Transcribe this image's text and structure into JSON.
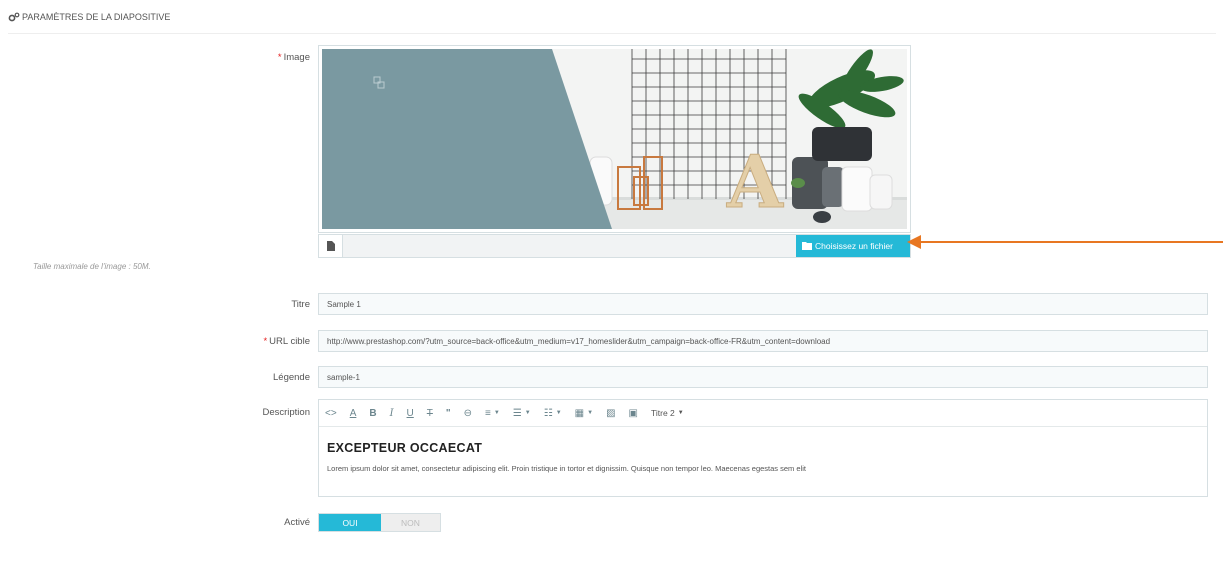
{
  "panel": {
    "heading": "PARAMÈTRES DE LA DIAPOSITIVE",
    "heading_icon": "cogs-icon"
  },
  "image_field": {
    "required_mark": "*",
    "label": "Image",
    "choose_button": "Choisissez un fichier",
    "help": "Taille maximale de l'image : 50M."
  },
  "title_field": {
    "label": "Titre",
    "value": "Sample 1"
  },
  "url_field": {
    "required_mark": "*",
    "label": "URL cible",
    "value": "http://www.prestashop.com/?utm_source=back-office&utm_medium=v17_homeslider&utm_campaign=back-office-FR&utm_content=download"
  },
  "legend_field": {
    "label": "Légende",
    "value": "sample-1"
  },
  "description_field": {
    "label": "Description",
    "style_dropdown": "Titre 2",
    "heading": "EXCEPTEUR OCCAECAT",
    "body": "Lorem ipsum dolor sit amet, consectetur adipiscing elit. Proin tristique in tortor et dignissim. Quisque non tempor leo. Maecenas egestas sem elit"
  },
  "active_field": {
    "label": "Activé",
    "on": "OUI",
    "off": "NON",
    "selected": "OUI"
  },
  "colors": {
    "accent": "#25b9d7",
    "required": "#e51f1f",
    "annotation_arrow": "#e87722"
  }
}
